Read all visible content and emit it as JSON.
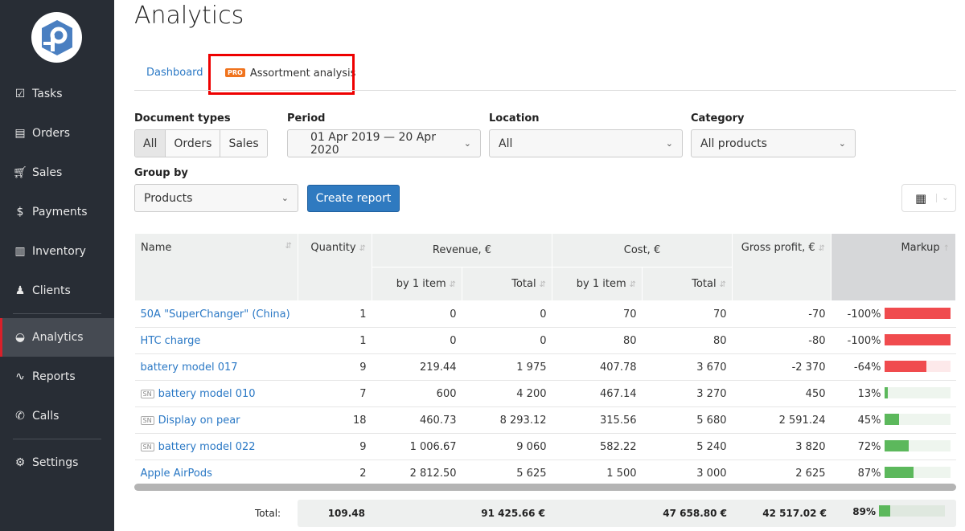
{
  "sidebar": {
    "items": [
      {
        "label": "Tasks",
        "icon": "clipboard-check-icon"
      },
      {
        "label": "Orders",
        "icon": "inbox-tray-icon"
      },
      {
        "label": "Sales",
        "icon": "cart-icon"
      },
      {
        "label": "Payments",
        "icon": "dollar-circle-icon"
      },
      {
        "label": "Inventory",
        "icon": "barcode-icon"
      },
      {
        "label": "Clients",
        "icon": "user-icon"
      },
      {
        "label": "Analytics",
        "icon": "speedometer-icon",
        "active": true
      },
      {
        "label": "Reports",
        "icon": "line-chart-icon"
      },
      {
        "label": "Calls",
        "icon": "phone-icon"
      },
      {
        "label": "Settings",
        "icon": "gear-icon"
      }
    ]
  },
  "header": {
    "title": "Analytics"
  },
  "tabs": [
    {
      "label": "Dashboard"
    },
    {
      "label": "Assortment analysis",
      "badge": "PRO",
      "active": true
    }
  ],
  "filters": {
    "document_types": {
      "label": "Document types",
      "options": [
        "All",
        "Orders",
        "Sales"
      ],
      "selected": "All"
    },
    "period": {
      "label": "Period",
      "value": "01 Apr 2019 — 20 Apr 2020"
    },
    "location": {
      "label": "Location",
      "value": "All"
    },
    "category": {
      "label": "Category",
      "value": "All products"
    },
    "group_by": {
      "label": "Group by",
      "value": "Products"
    },
    "create_report": "Create report"
  },
  "table": {
    "headers": {
      "name": "Name",
      "quantity": "Quantity",
      "revenue": "Revenue, €",
      "cost": "Cost, €",
      "gross_profit": "Gross profit, €",
      "markup": "Markup",
      "by_item": "by 1 item",
      "total": "Total"
    },
    "rows": [
      {
        "name": "50A \"SuperChanger\" (China)",
        "sn": false,
        "qty": "1",
        "rev_item": "0",
        "rev_total": "0",
        "cost_item": "70",
        "cost_total": "70",
        "profit": "-70",
        "markup": "-100%",
        "fill": 1.0,
        "neg": true
      },
      {
        "name": "HTC charge",
        "sn": false,
        "qty": "1",
        "rev_item": "0",
        "rev_total": "0",
        "cost_item": "80",
        "cost_total": "80",
        "profit": "-80",
        "markup": "-100%",
        "fill": 1.0,
        "neg": true
      },
      {
        "name": "battery model 017",
        "sn": false,
        "qty": "9",
        "rev_item": "219.44",
        "rev_total": "1 975",
        "cost_item": "407.78",
        "cost_total": "3 670",
        "profit": "-2 370",
        "markup": "-64%",
        "fill": 0.64,
        "neg": true
      },
      {
        "name": "battery model 010",
        "sn": true,
        "qty": "7",
        "rev_item": "600",
        "rev_total": "4 200",
        "cost_item": "467.14",
        "cost_total": "3 270",
        "profit": "450",
        "markup": "13%",
        "fill": 0.06,
        "neg": false
      },
      {
        "name": "Display on pear",
        "sn": true,
        "qty": "18",
        "rev_item": "460.73",
        "rev_total": "8 293.12",
        "cost_item": "315.56",
        "cost_total": "5 680",
        "profit": "2 591.24",
        "markup": "45%",
        "fill": 0.23,
        "neg": false
      },
      {
        "name": "battery model 022",
        "sn": true,
        "qty": "9",
        "rev_item": "1 006.67",
        "rev_total": "9 060",
        "cost_item": "582.22",
        "cost_total": "5 240",
        "profit": "3 820",
        "markup": "72%",
        "fill": 0.37,
        "neg": false
      },
      {
        "name": "Apple AirPods",
        "sn": false,
        "qty": "2",
        "rev_item": "2 812.50",
        "rev_total": "5 625",
        "cost_item": "1 500",
        "cost_total": "3 000",
        "profit": "2 625",
        "markup": "87%",
        "fill": 0.45,
        "neg": false
      }
    ],
    "sn_badge": "SN",
    "totals": {
      "label": "Total:",
      "qty": "109.48",
      "revenue": "91 425.66 €",
      "cost": "47 658.80 €",
      "profit": "42 517.02 €",
      "markup": "89%",
      "fill": 0.17
    }
  },
  "colors": {
    "accent": "#2f7ac0",
    "negative": "#f04b4e",
    "positive": "#4caf50",
    "sidebar": "#282d35"
  }
}
